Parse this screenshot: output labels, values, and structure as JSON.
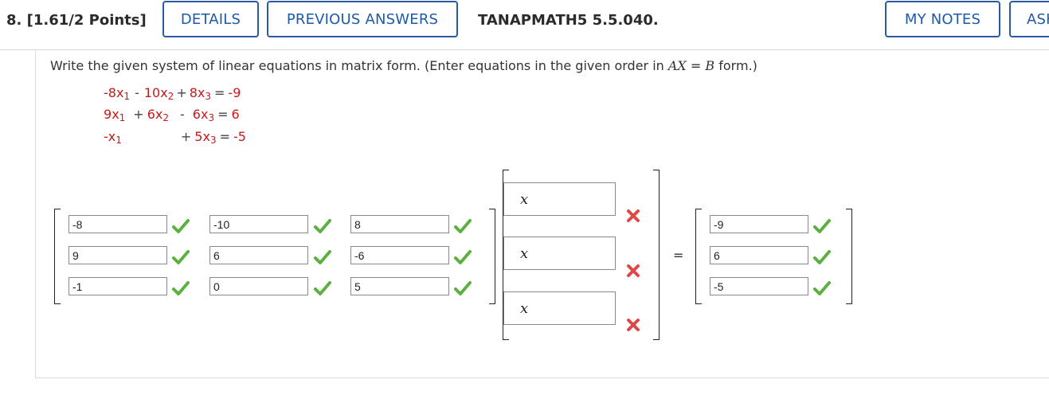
{
  "header": {
    "question_number": "8. [1.61/2 Points]",
    "details_label": "DETAILS",
    "previous_answers_label": "PREVIOUS ANSWERS",
    "reference": "TANAPMATH5 5.5.040.",
    "my_notes_label": "MY NOTES",
    "ask_label": "ASK"
  },
  "instruction": {
    "text_before": "Write the given system of linear equations in matrix form. (Enter equations in the given order in ",
    "lhs": "AX",
    "equals": " = ",
    "rhs": "B",
    "text_after": " form.)"
  },
  "system": [
    {
      "t1_coef": "-8",
      "t1_var": "x",
      "t1_sub": "1",
      "op2": "-",
      "t2_coef": "10",
      "t2_var": "x",
      "t2_sub": "2",
      "op3": "+",
      "t3_coef": "8",
      "t3_var": "x",
      "t3_sub": "3",
      "eq": "=",
      "rhs": "-9"
    },
    {
      "t1_coef": "9",
      "t1_var": "x",
      "t1_sub": "1",
      "op2": "+",
      "t2_coef": "6",
      "t2_var": "x",
      "t2_sub": "2",
      "op3": "-",
      "t3_coef": "6",
      "t3_var": "x",
      "t3_sub": "3",
      "eq": "=",
      "rhs": "6"
    },
    {
      "t1_coef": "-",
      "t1_var": "x",
      "t1_sub": "1",
      "op3": "+",
      "t3_coef": "5",
      "t3_var": "x",
      "t3_sub": "3",
      "eq": "=",
      "rhs": "-5"
    }
  ],
  "matrix_a": [
    [
      "-8",
      "-10",
      "8"
    ],
    [
      "9",
      "6",
      "-6"
    ],
    [
      "-1",
      "0",
      "5"
    ]
  ],
  "matrix_x": [
    "x",
    "x",
    "x"
  ],
  "equals_sign": "=",
  "matrix_b": [
    "-9",
    "6",
    "-5"
  ],
  "colors": {
    "accent": "#2a5aa0",
    "correct": "#5cb040",
    "incorrect": "#e04848",
    "coefficient_red": "#c81919"
  }
}
